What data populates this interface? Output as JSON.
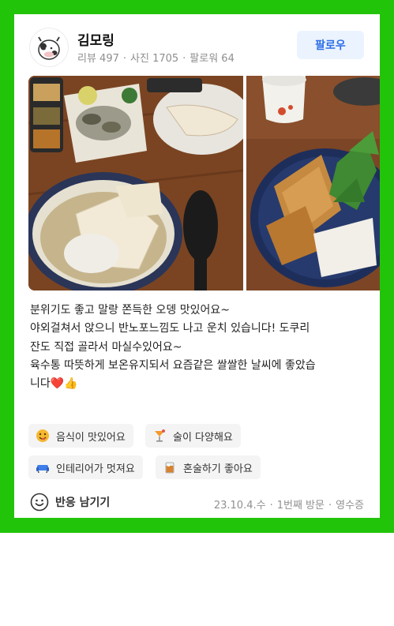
{
  "user": {
    "name": "김모링",
    "stats": [
      "리뷰 497",
      "사진 1705",
      "팔로워 64"
    ]
  },
  "follow_label": "팔로우",
  "review_text": "분위기도 좋고 말랑 쫀득한 오뎅 맛있어요~\n야외걸쳐서 앉으니 반노포느낌도 나고 운치 있습니다! 도쿠리\n잔도 직접 골라서 마실수있어요~\n육수통 따뜻하게 보온유지되서 요즘같은 쌀쌀한 날씨에 좋았습\n니다❤️👍",
  "tags": [
    {
      "label": "음식이 맛있어요",
      "icon": "yummy-face-icon"
    },
    {
      "label": "술이 다양해요",
      "icon": "cocktail-icon"
    },
    {
      "label": "인테리어가 멋져요",
      "icon": "sofa-icon"
    },
    {
      "label": "혼술하기 좋아요",
      "icon": "drink-glass-icon"
    }
  ],
  "reaction_label": "반응 남기기",
  "visit_meta": [
    "23.10.4.수",
    "1번째 방문",
    "영수증"
  ],
  "colors": {
    "frame": "#22c40a",
    "follow_bg": "#ebf3fe",
    "follow_text": "#2e6fe8"
  }
}
